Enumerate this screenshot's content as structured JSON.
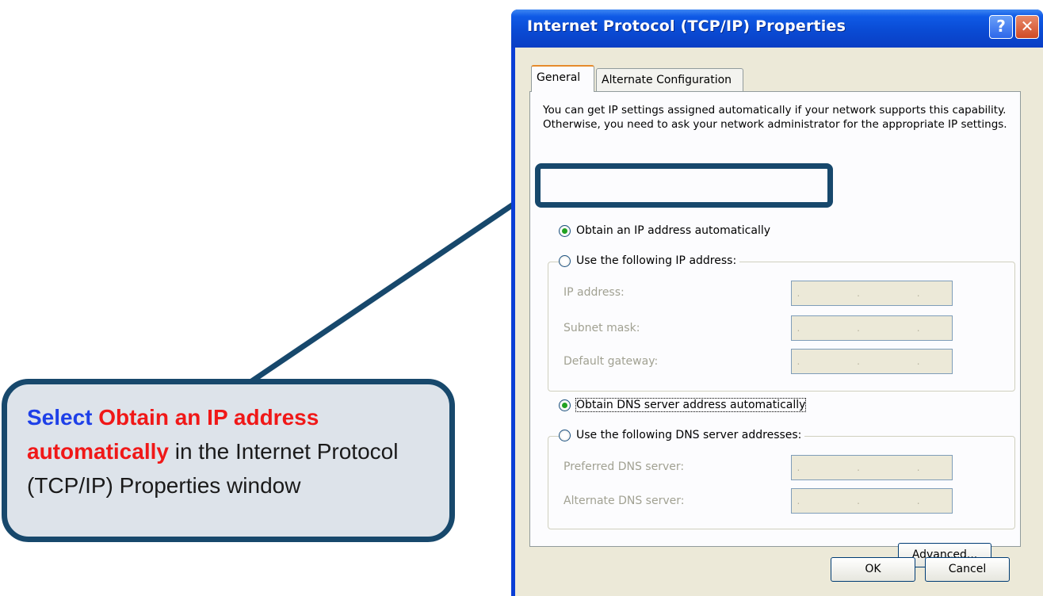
{
  "window": {
    "title": "Internet Protocol (TCP/IP) Properties",
    "help_label": "?",
    "close_label": "✕"
  },
  "tabs": [
    {
      "label": "General",
      "active": true
    },
    {
      "label": "Alternate Configuration",
      "active": false
    }
  ],
  "intro_text": "You can get IP settings assigned automatically if your network supports this capability. Otherwise, you need to ask your network administrator for the appropriate IP settings.",
  "ip_options": {
    "auto_label": "Obtain an IP address automatically",
    "auto_selected": true,
    "manual_label": "Use the following IP address:",
    "fields": [
      {
        "label": "IP address:",
        "value": ". . ."
      },
      {
        "label": "Subnet mask:",
        "value": ". . ."
      },
      {
        "label": "Default gateway:",
        "value": ". . ."
      }
    ]
  },
  "dns_options": {
    "auto_label": "Obtain DNS server address automatically",
    "auto_selected": true,
    "manual_label": "Use the following DNS server addresses:",
    "fields": [
      {
        "label": "Preferred DNS server:",
        "value": ". . ."
      },
      {
        "label": "Alternate DNS server:",
        "value": ". . ."
      }
    ]
  },
  "buttons": {
    "advanced": "Advanced...",
    "ok": "OK",
    "cancel": "Cancel"
  },
  "callout": {
    "part1": "Select ",
    "part2": "Obtain an IP address automatically",
    "part3": " in the Internet Protocol (TCP/IP) Properties window"
  },
  "colors": {
    "callout_border": "#17486c",
    "callout_fill": "#dde3ea",
    "select_text": "#1e40e8",
    "emphasis_text": "#f01818",
    "titlebar": "#0a4bd4"
  }
}
